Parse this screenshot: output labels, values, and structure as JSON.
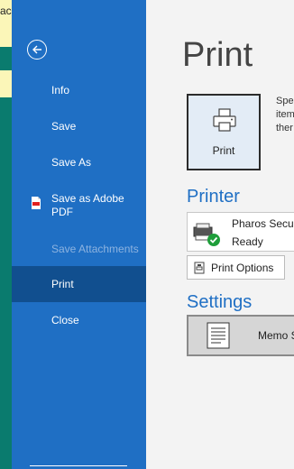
{
  "background": {
    "cut_text": "ac"
  },
  "nav": {
    "back_icon": "back-arrow-icon",
    "items": [
      {
        "label": "Info",
        "state": "normal"
      },
      {
        "label": "Save",
        "state": "normal"
      },
      {
        "label": "Save As",
        "state": "normal"
      },
      {
        "label": "Save as Adobe PDF",
        "line1": "Save as Adobe",
        "line2": "PDF",
        "state": "normal",
        "icon": "pdf-icon"
      },
      {
        "label": "Save Attachments",
        "state": "disabled"
      },
      {
        "label": "Print",
        "state": "selected"
      },
      {
        "label": "Close",
        "state": "normal"
      }
    ]
  },
  "main": {
    "title": "Print",
    "print_button": {
      "label": "Print",
      "icon": "printer-icon"
    },
    "description_lines": [
      "Spe",
      "item",
      "ther"
    ],
    "printer": {
      "heading": "Printer",
      "name": "Pharos Secur",
      "status": "Ready",
      "icon": "printer-ready-icon"
    },
    "print_options": {
      "label": "Print Options",
      "icon": "print-options-icon"
    },
    "settings": {
      "heading": "Settings",
      "style_label": "Memo S",
      "icon": "memo-style-icon"
    }
  },
  "colors": {
    "nav_bg": "#1f6fc4",
    "nav_selected": "#114f8f",
    "accent": "#1f6fc4",
    "main_bg": "#f3f3f3"
  }
}
